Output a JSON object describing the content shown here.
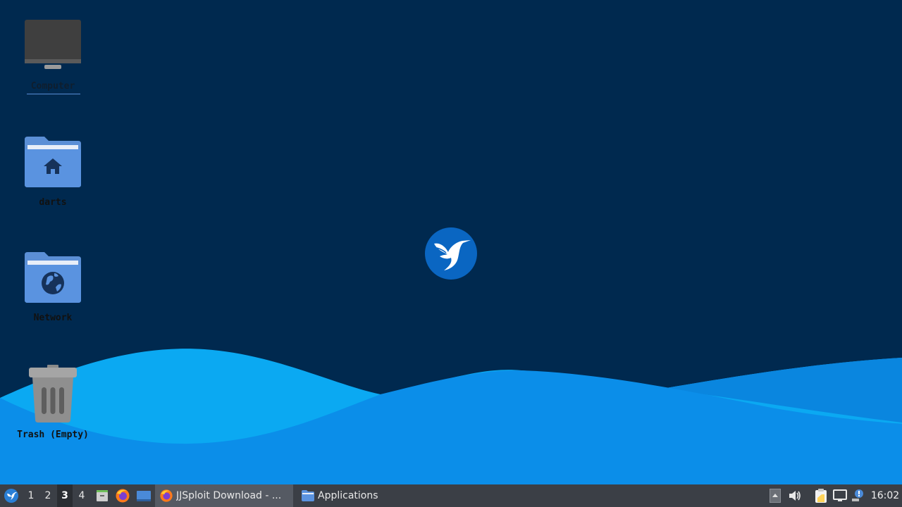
{
  "desktop": {
    "icons": [
      {
        "label": "Computer"
      },
      {
        "label": "darts"
      },
      {
        "label": "Network"
      },
      {
        "label": "Trash (Empty)"
      }
    ]
  },
  "taskbar": {
    "workspaces": [
      "1",
      "2",
      "3",
      "4"
    ],
    "active_workspace": "3",
    "launchers": [
      "file-manager-icon",
      "firefox-icon",
      "show-desktop-icon"
    ],
    "tasks": [
      {
        "label": "JJSploit Download - ...",
        "icon": "firefox-icon",
        "active": true
      },
      {
        "label": "Applications",
        "icon": "folder-icon",
        "active": false
      }
    ],
    "tray": [
      "up-arrow-icon",
      "volume-icon",
      "clipboard-icon",
      "network-icon",
      "notification-icon"
    ],
    "clock": "16:02"
  },
  "colors": {
    "background": "#00294f",
    "wave_light": "#0aa6f0",
    "wave_mid": "#0b8ee8",
    "taskbar": "#3b3f46",
    "accent": "#0a66c2"
  }
}
